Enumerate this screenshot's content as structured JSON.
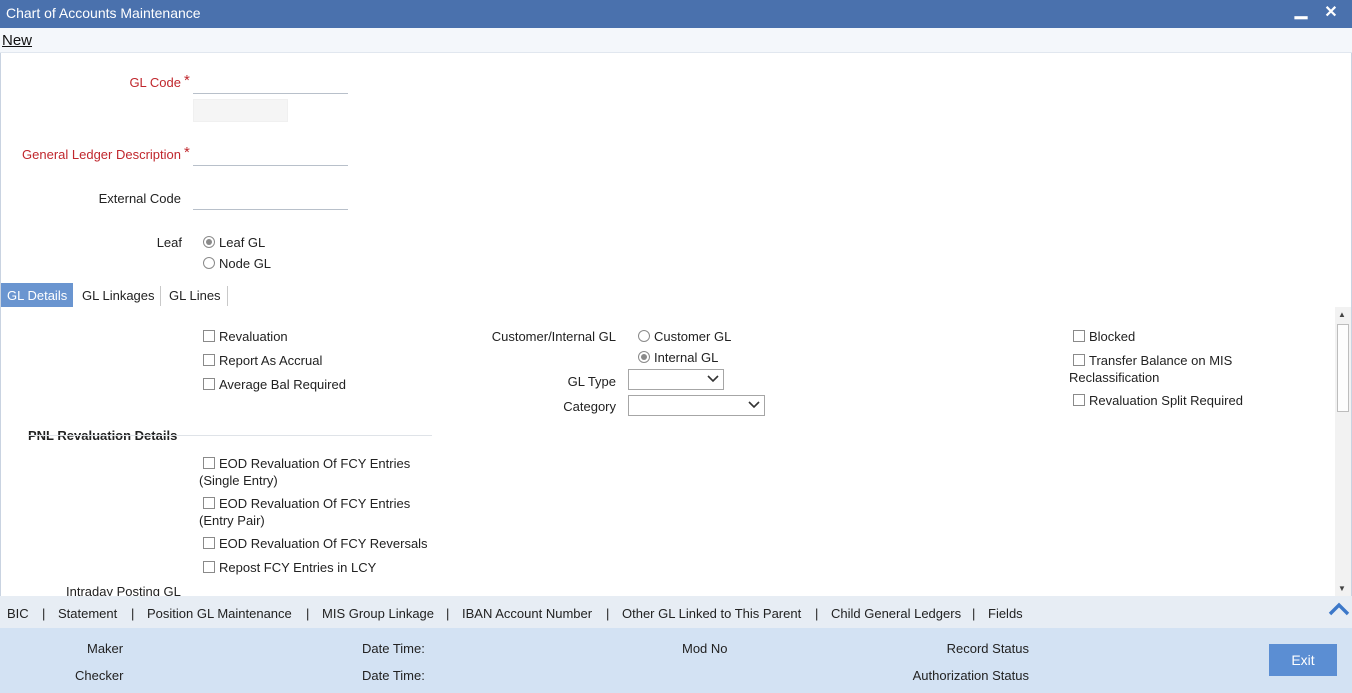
{
  "window": {
    "title": "Chart of Accounts Maintenance",
    "minimize_glyph": "▁",
    "close_glyph": "✕"
  },
  "menu": {
    "new_label": "New"
  },
  "form": {
    "gl_code_label": "GL Code",
    "gl_desc_label": "General Ledger Description",
    "required_mark": "*",
    "external_code_label": "External Code",
    "leaf_label": "Leaf",
    "leaf_options": [
      "Leaf GL",
      "Node GL"
    ]
  },
  "tabs": [
    "GL Details",
    "GL Linkages",
    "GL Lines"
  ],
  "gl_details": {
    "checkboxes_left": [
      "Revaluation",
      "Report As Accrual",
      "Average Bal Required"
    ],
    "customer_internal_label": "Customer/Internal GL",
    "customer_internal_options": [
      "Customer GL",
      "Internal GL"
    ],
    "gl_type_label": "GL Type",
    "category_label": "Category",
    "checkboxes_right": [
      "Blocked",
      "Transfer Balance on MIS",
      "Reclassification",
      "Revaluation Split Required"
    ],
    "pnl_section_title": "PNL Revaluation Details",
    "pnl_checkboxes": [
      {
        "line1": "EOD Revaluation Of FCY Entries",
        "line2": "(Single Entry)"
      },
      {
        "line1": "EOD Revaluation Of FCY Entries",
        "line2": "(Entry Pair)"
      },
      {
        "line1": "EOD Revaluation Of FCY Reversals",
        "line2": ""
      },
      {
        "line1": "Repost FCY Entries in LCY",
        "line2": ""
      }
    ],
    "intraday_label": "Intraday Posting GL"
  },
  "links": [
    "BIC",
    "Statement",
    "Position GL Maintenance",
    "MIS Group Linkage",
    "IBAN Account Number",
    "Other GL Linked to This Parent",
    "Child General Ledgers",
    "Fields"
  ],
  "link_separator": "|",
  "audit": {
    "maker": "Maker",
    "checker": "Checker",
    "date_time_1": "Date Time:",
    "date_time_2": "Date Time:",
    "mod_no": "Mod No",
    "record_status": "Record Status",
    "authorization_status": "Authorization Status",
    "exit_label": "Exit"
  }
}
